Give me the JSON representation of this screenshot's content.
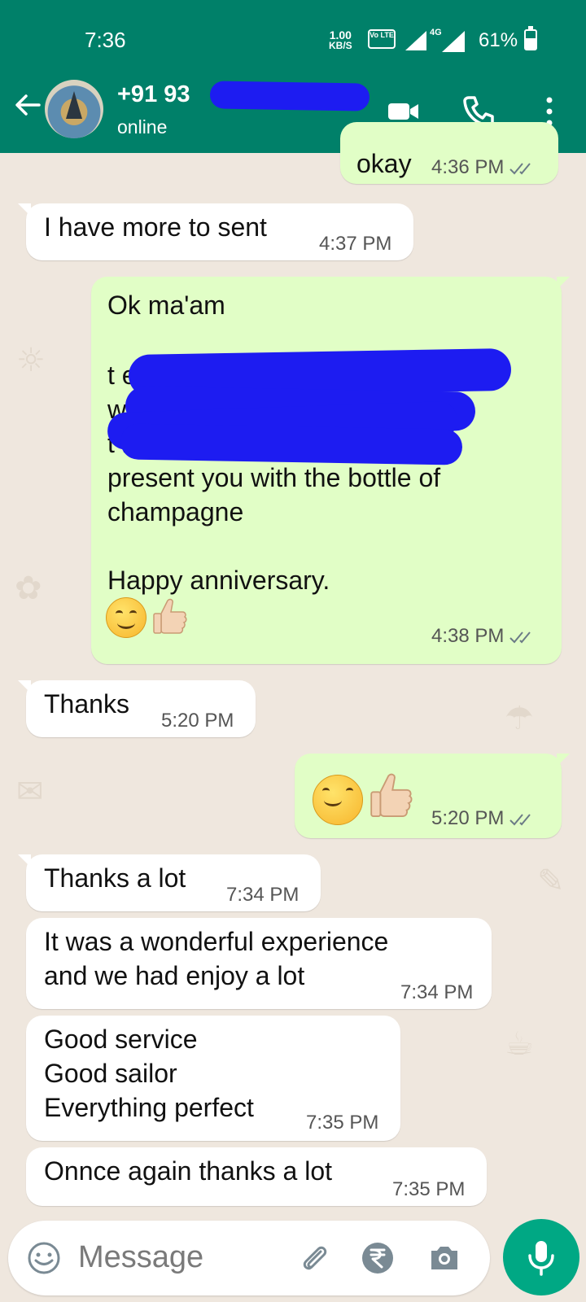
{
  "status_bar": {
    "time": "7:36",
    "net_speed_value": "1.00",
    "net_speed_unit": "KB/S",
    "volte_label": "Vo LTE",
    "network_type": "4G",
    "battery_percent": "61%",
    "battery_level": 0.61
  },
  "header": {
    "contact_name": "+91 93",
    "status": "online",
    "accent_color": "#008069"
  },
  "messages": [
    {
      "dir": "out",
      "text": "okay",
      "time": "4:36 PM",
      "read": true
    },
    {
      "dir": "in",
      "text": "I have more to sent",
      "time": "4:37 PM"
    },
    {
      "dir": "out",
      "text_top": "Ok ma'am",
      "text_visible": "present you with the bottle of\nchampagne\n\nHappy anniversary.",
      "time": "4:38 PM",
      "read": true
    },
    {
      "dir": "in",
      "text": "Thanks",
      "time": "5:20 PM"
    },
    {
      "dir": "out",
      "text": "",
      "time": "5:20 PM",
      "read": true
    },
    {
      "dir": "in",
      "text": "Thanks a lot",
      "time": "7:34 PM"
    },
    {
      "dir": "in",
      "text": "It was a wonderful experience\nand we had enjoy a lot",
      "time": "7:34 PM"
    },
    {
      "dir": "in",
      "text": "Good service\nGood sailor\nEverything perfect",
      "time": "7:35 PM"
    },
    {
      "dir": "in",
      "text": "Onnce again thanks a lot",
      "time": "7:35 PM"
    }
  ],
  "input": {
    "placeholder": "Message"
  },
  "colors": {
    "incoming_bubble": "#ffffff",
    "outgoing_bubble": "#e1fec6",
    "read_ticks": "#53bdeb",
    "send_button": "#00a884"
  }
}
